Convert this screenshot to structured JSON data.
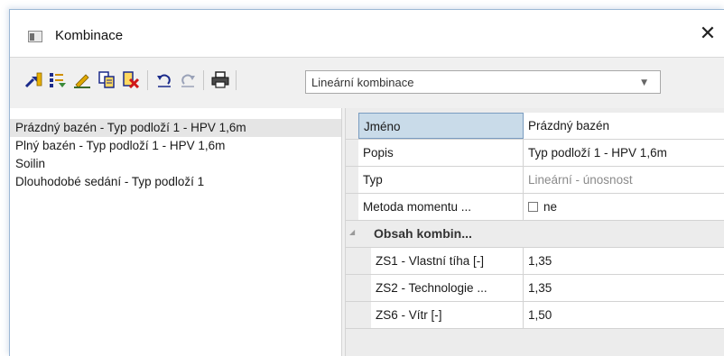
{
  "window": {
    "title": "Kombinace",
    "close_glyph": "✕"
  },
  "toolbar": {
    "icons": [
      "new-combination-icon",
      "generate-combinations-icon",
      "edit-icon",
      "copy-icon",
      "delete-icon",
      "undo-icon",
      "redo-icon",
      "print-icon"
    ],
    "combo_value": "Lineární kombinace"
  },
  "list": {
    "items": [
      "Prázdný bazén - Typ podloží 1 - HPV 1,6m",
      "Plný bazén - Typ podloží 1 - HPV 1,6m",
      "Soilin",
      "Dlouhodobé sedání - Typ podloží 1"
    ],
    "selected_index": 0
  },
  "properties": {
    "rows": [
      {
        "name": "Jméno",
        "value": "Prázdný bazén"
      },
      {
        "name": "Popis",
        "value": "Typ podloží 1 - HPV 1,6m"
      },
      {
        "name": "Typ",
        "value": "Lineární - únosnost"
      },
      {
        "name": "Metoda momentu ...",
        "value": "ne"
      }
    ],
    "category": {
      "label": "Obsah kombin...",
      "rows": [
        {
          "name": "ZS1 - Vlastní tíha [-]",
          "value": "1,35"
        },
        {
          "name": "ZS2 - Technologie ...",
          "value": "1,35"
        },
        {
          "name": "ZS6 - Vítr [-]",
          "value": "1,50"
        }
      ]
    }
  },
  "colors": {
    "selection": "#c9dbe9",
    "toolbar_bg": "#f0f0f0"
  }
}
